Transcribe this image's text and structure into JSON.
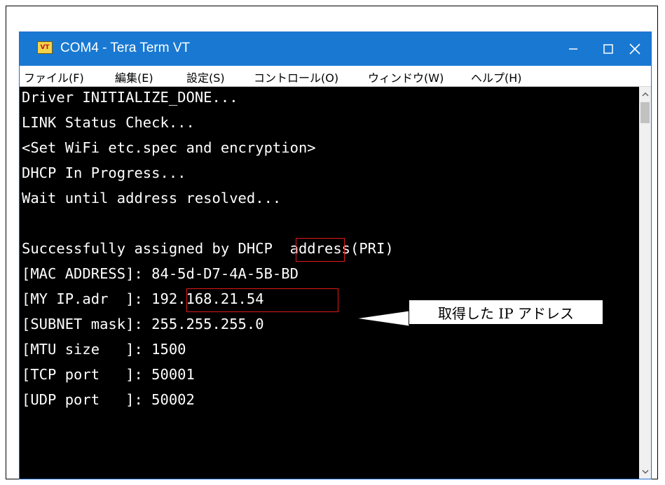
{
  "window": {
    "title": "COM4 - Tera Term VT",
    "icon_label": "VT",
    "icon": "tera-term-icon",
    "controls": [
      "minimize-icon",
      "maximize-icon",
      "close-icon"
    ]
  },
  "menu": [
    {
      "label": "ファイル(F)"
    },
    {
      "label": "編集(E)"
    },
    {
      "label": "設定(S)"
    },
    {
      "label": "コントロール(O)"
    },
    {
      "label": "ウィンドウ(W)"
    },
    {
      "label": "ヘルプ(H)"
    }
  ],
  "terminal": {
    "lines": [
      "Driver INITIALIZE_DONE...",
      "LINK Status Check...",
      "<Set WiFi etc.spec and encryption>",
      "DHCP In Progress...",
      "Wait until address resolved...",
      "",
      "Successfully assigned by DHCP  address(PRI)",
      "[MAC ADDRESS]: 84-5d-D7-4A-5B-BD",
      "[MY IP.adr  ]: 192.168.21.54",
      "[SUBNET mask]: 255.255.255.0",
      "[MTU size   ]: 1500",
      "[TCP port   ]: 50001",
      "[UDP port   ]: 50002"
    ]
  },
  "annotation": {
    "callout_text": "取得した IP アドレス",
    "highlight_color": "#e01818"
  },
  "colors": {
    "titlebar": "#1979d2",
    "terminal_bg": "#000000",
    "terminal_fg": "#ffffff"
  }
}
